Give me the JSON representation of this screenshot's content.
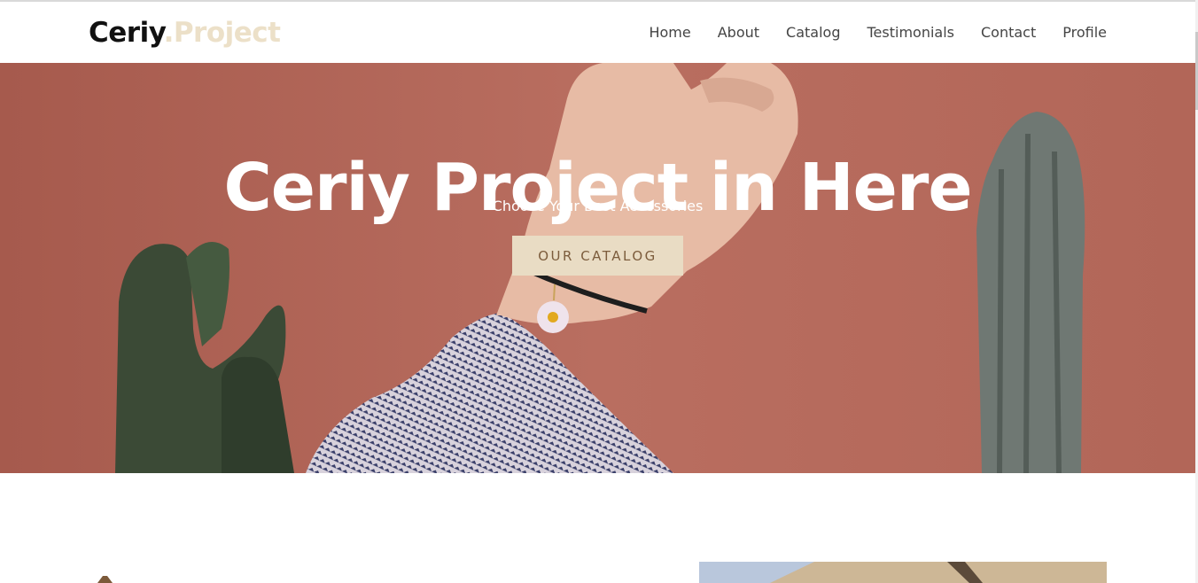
{
  "brand": {
    "part1": "Ceriy",
    "part2": ".Project"
  },
  "nav": {
    "items": [
      "Home",
      "About",
      "Catalog",
      "Testimonials",
      "Contact",
      "Profile"
    ]
  },
  "hero": {
    "title": "Ceriy Project in Here",
    "subtitle": "Choose Your Best Accessories",
    "cta_label": "OUR CATALOG"
  },
  "colors": {
    "brand_dark": "#111111",
    "brand_accent": "#ece0c8",
    "hero_background": "#b6695b",
    "button_background": "#e9dcc4",
    "button_text": "#7c5c3c",
    "nav_text": "#444444"
  }
}
